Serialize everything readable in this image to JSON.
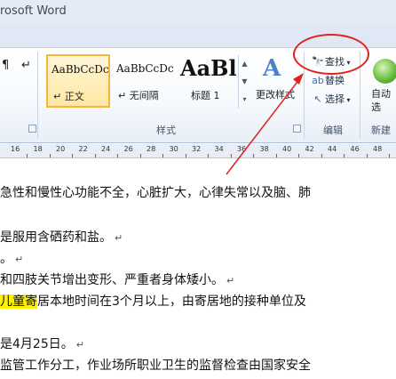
{
  "window": {
    "title": "rosoft Word"
  },
  "ribbon": {
    "paragraph_buttons": [
      "¶",
      "↵"
    ],
    "styles": [
      {
        "sample": "AaBbCcDc",
        "name": "↵ 正文",
        "selected": true
      },
      {
        "sample": "AaBbCcDc",
        "name": "↵ 无间隔",
        "selected": false
      },
      {
        "sample": "AaBl",
        "name": "标题 1",
        "selected": false
      }
    ],
    "change_styles_label": "更改样式",
    "styles_group_label": "样式",
    "editing": {
      "find_label": "查找",
      "replace_label": "替换",
      "select_label": "选择",
      "group_label": "编辑"
    },
    "new_group": {
      "label": "自动\n选",
      "group_label": "新建"
    }
  },
  "ruler": {
    "ticks": [
      "16",
      "18",
      "20",
      "22",
      "24",
      "26",
      "28",
      "30",
      "32",
      "34",
      "36",
      "38",
      "40",
      "42",
      "44",
      "46",
      "48"
    ]
  },
  "document": {
    "lines": [
      {
        "text": "急性和慢性心功能不全，心脏扩大，心律失常以及脑、肺",
        "mark": ""
      },
      {
        "text": "是服用含硒药和盐。",
        "mark": "↵"
      },
      {
        "text": "。",
        "mark": "↵"
      },
      {
        "text": "和四肢关节增出变形、严重者身体矮小。",
        "mark": "↵"
      },
      {
        "highlight": "儿童寄",
        "text": "居本地时间在3个月以上，由寄居地的接种单位及",
        "mark": ""
      },
      {
        "text": "是4月25日。",
        "mark": "↵"
      },
      {
        "text": "监管工作分工，作业场所职业卫生的监督检查由国家安全",
        "mark": ""
      }
    ]
  },
  "colors": {
    "annotation": "#e2211c",
    "selected_style": "#f3b73d",
    "highlight": "#fff200"
  }
}
